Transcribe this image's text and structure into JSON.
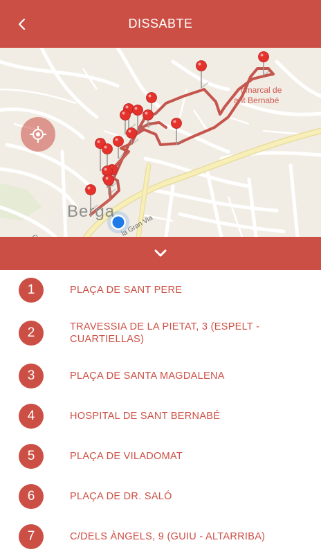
{
  "header": {
    "title": "DISSABTE",
    "back_icon": "chevron-left-icon"
  },
  "map": {
    "labels": {
      "town": "Berga",
      "place_line1": "omarcal de",
      "place_line2": "ant Bernabé",
      "street": "la Gran Via",
      "street_edge": "Ca"
    },
    "locate_icon": "crosshair-icon",
    "colors": {
      "route": "#c0443c",
      "pin": "#e5322d",
      "user_location": "#1f7be8",
      "land": "#f1ede4",
      "road": "#ffffff",
      "main_road": "#f6e8a6"
    }
  },
  "collapse": {
    "icon": "chevron-down-icon"
  },
  "stops": [
    {
      "number": "1",
      "name": "PLAÇA DE SANT PERE"
    },
    {
      "number": "2",
      "name": "TRAVESSIA DE LA PIETAT, 3 (ESPELT - CUARTIELLAS)"
    },
    {
      "number": "3",
      "name": "PLAÇA DE SANTA MAGDALENA"
    },
    {
      "number": "4",
      "name": "HOSPITAL DE SANT BERNABÉ"
    },
    {
      "number": "5",
      "name": "PLAÇA DE VILADOMAT"
    },
    {
      "number": "6",
      "name": "PLAÇA DE DR. SALÓ"
    },
    {
      "number": "7",
      "name": "C/DELS ÀNGELS, 9 (GUIU - ALTARRIBA)"
    }
  ],
  "theme": {
    "accent": "#cc4f45"
  }
}
